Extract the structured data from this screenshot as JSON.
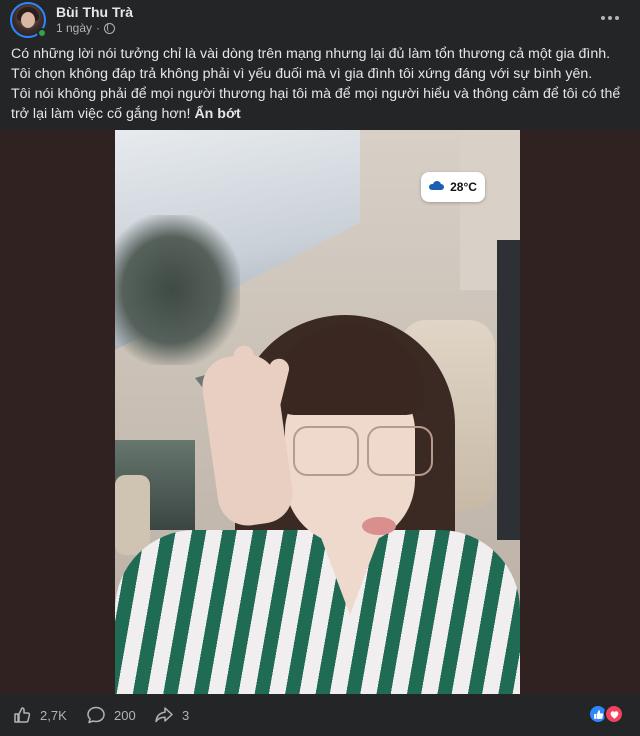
{
  "author": {
    "name": "Bùi Thu Trà",
    "timestamp": "1 ngày",
    "separator": "·"
  },
  "post": {
    "lines": [
      "Có những lời nói tưởng chỉ là vài dòng trên mạng nhưng lại đủ làm tổn thương cả một gia đình.",
      "Tôi chọn không đáp trả không phải vì yếu đuối mà vì gia đình tôi xứng đáng với sự bình yên.",
      "Tôi nói không phải để mọi người thương hại tôi mà để mọi người hiểu và thông cảm để tôi có thể",
      "trở lại làm việc cố gắng hơn!"
    ],
    "see_less": "Ẩn bớt"
  },
  "media": {
    "weather_temp": "28°C",
    "weather_icon": "rain-cloud-icon"
  },
  "footer": {
    "likes": "2,7K",
    "comments": "200",
    "shares": "3",
    "reactions": [
      "like-icon",
      "love-icon"
    ]
  },
  "colors": {
    "background": "#242526",
    "text": "#e4e6eb",
    "secondary_text": "#b0b3b8",
    "accent": "#2d88ff",
    "love": "#f3425f",
    "online": "#31a24c"
  }
}
